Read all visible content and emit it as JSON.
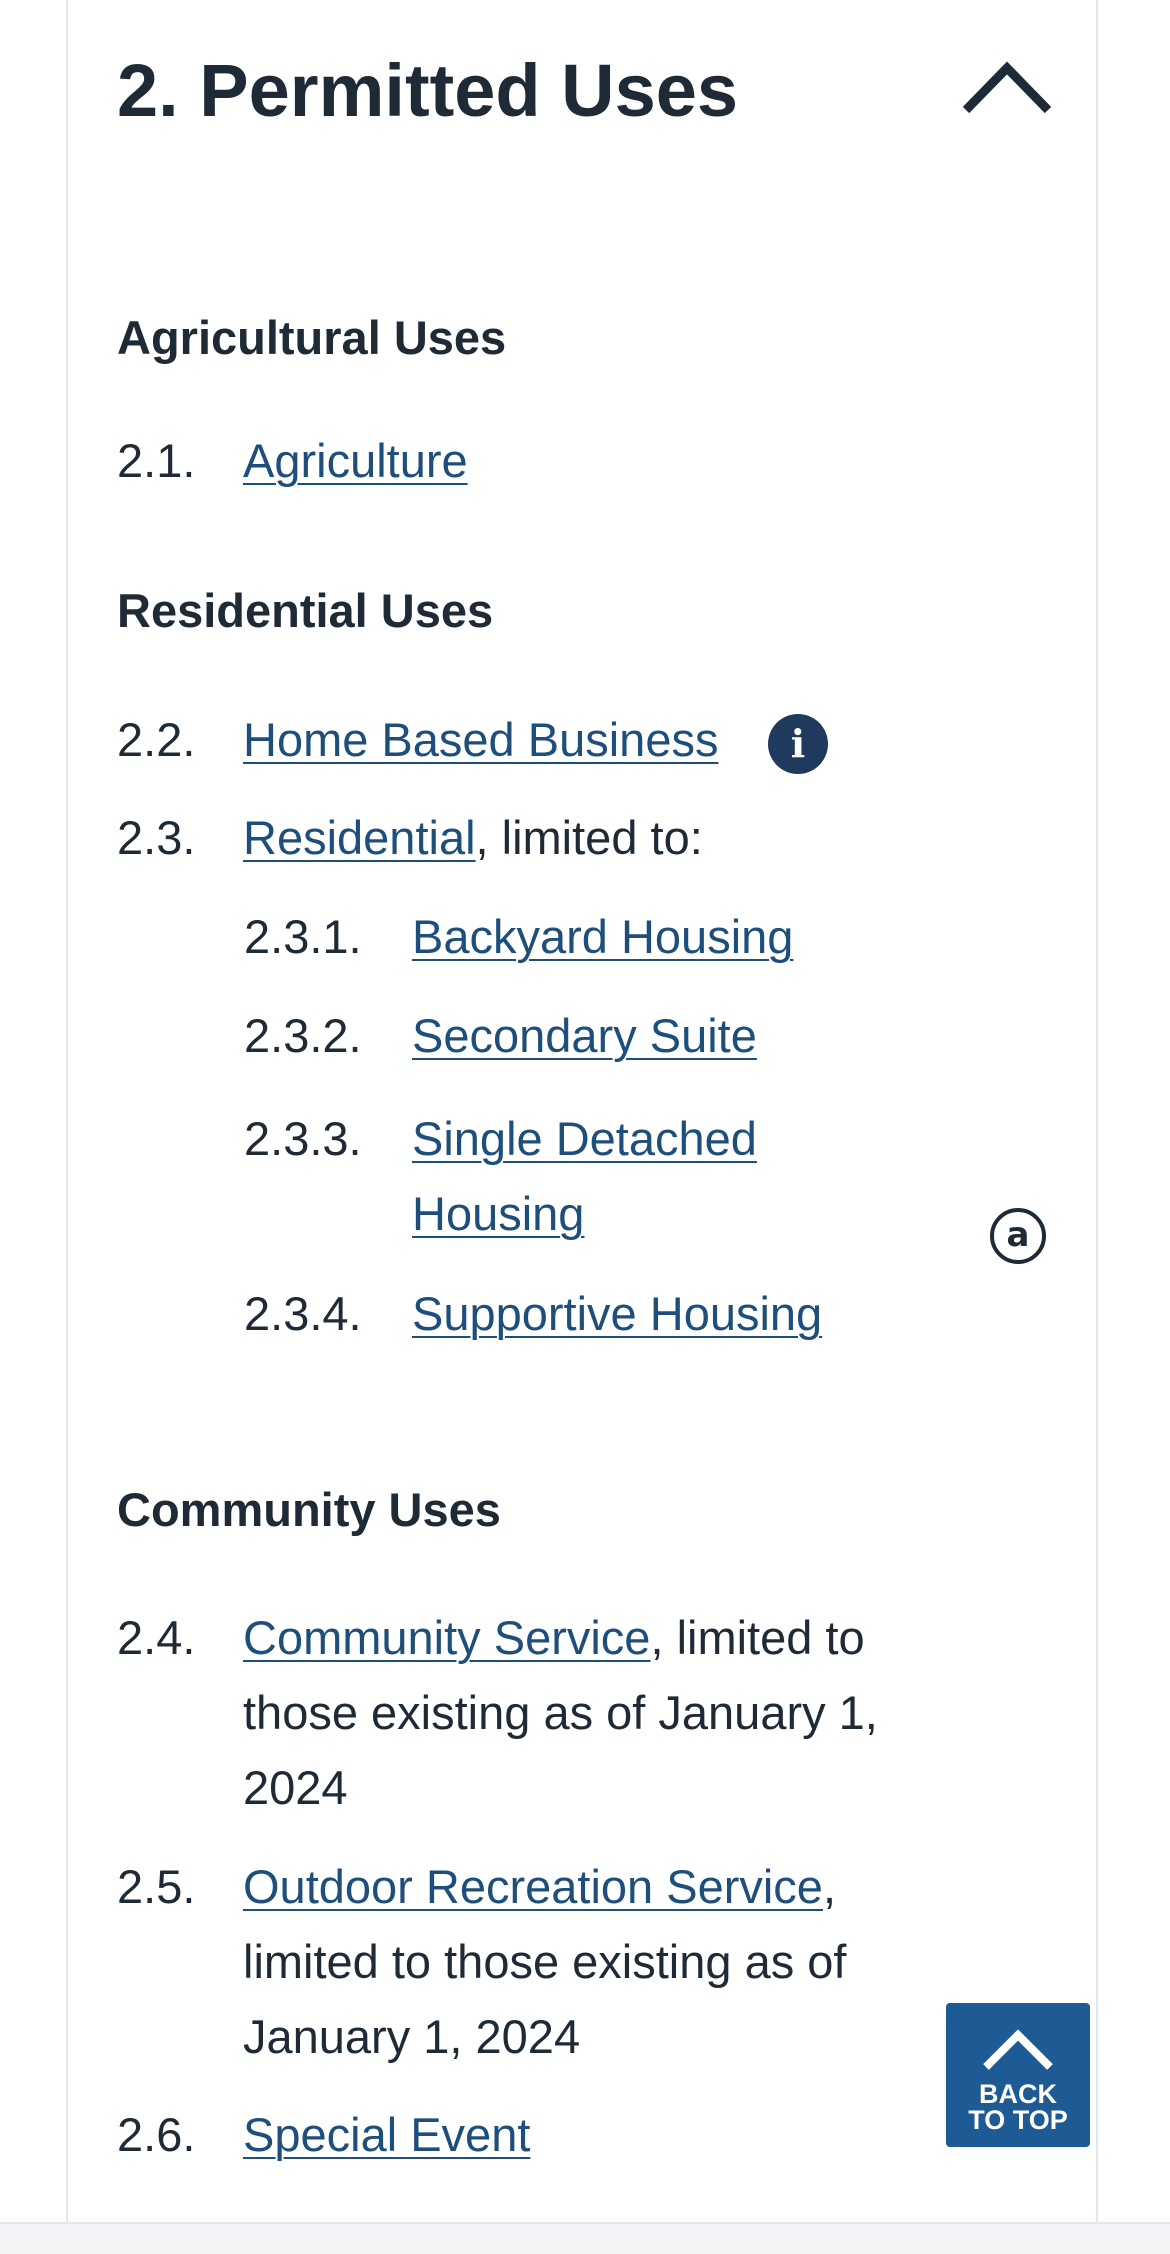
{
  "section": {
    "title": "2. Permitted Uses"
  },
  "groups": {
    "agricultural": {
      "heading": "Agricultural Uses"
    },
    "residential": {
      "heading": "Residential Uses"
    },
    "community": {
      "heading": "Community Uses"
    }
  },
  "items": {
    "i21": {
      "number": "2.1.",
      "link": "Agriculture",
      "suffix": ""
    },
    "i22": {
      "number": "2.2.",
      "link": "Home Based Business",
      "suffix": ""
    },
    "i23": {
      "number": "2.3.",
      "link": "Residential",
      "suffix": ", limited to:"
    },
    "i231": {
      "number": "2.3.1.",
      "link": "Backyard Housing"
    },
    "i232": {
      "number": "2.3.2.",
      "link": "Secondary Suite"
    },
    "i233": {
      "number": "2.3.3.",
      "link": "Single Detached Housing"
    },
    "i234": {
      "number": "2.3.4.",
      "link": "Supportive Housing"
    },
    "i24": {
      "number": "2.4.",
      "link": "Community Service",
      "suffix": ", limited to those existing as of January 1, 2024"
    },
    "i25": {
      "number": "2.5.",
      "link": "Outdoor Recreation Service",
      "suffix": ", limited to those existing as of January 1, 2024"
    },
    "i26": {
      "number": "2.6.",
      "link": "Special Event",
      "suffix": ""
    }
  },
  "icons": {
    "info": "i",
    "anchor": "a",
    "collapse": "chevron-up-icon"
  },
  "back_to_top": {
    "label": "BACK\nTO TOP"
  },
  "colors": {
    "text": "#1f2a37",
    "link": "#1e4f7c",
    "info_badge": "#1f3a5c",
    "back_to_top_bg": "#1e5a94"
  }
}
